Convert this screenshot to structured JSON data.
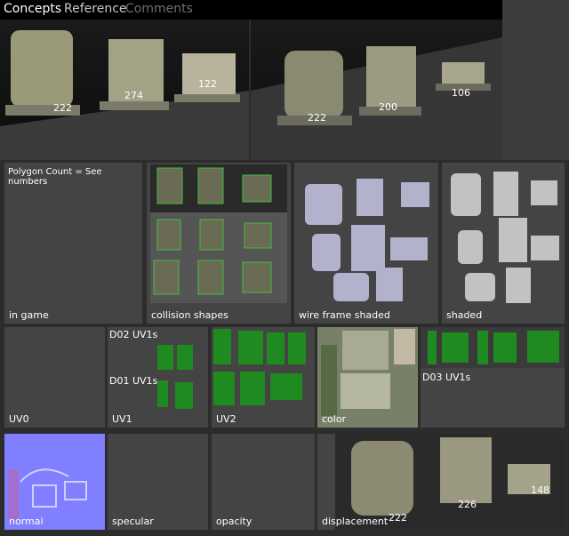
{
  "tabs": [
    {
      "label": "Concepts"
    },
    {
      "label": "Reference"
    },
    {
      "label": "Comments"
    }
  ],
  "hero_left": {
    "counts": [
      "222",
      "274",
      "122"
    ]
  },
  "hero_right": {
    "counts": [
      "222",
      "200",
      "106"
    ]
  },
  "row2": {
    "in_game": {
      "label": "in game",
      "note": "Polygon Count = See numbers"
    },
    "collision": {
      "label": "collision shapes"
    },
    "wireframe": {
      "label": "wire frame shaded"
    },
    "shaded": {
      "label": "shaded"
    }
  },
  "row3": {
    "uv0": {
      "label": "UV0"
    },
    "uv1": {
      "label": "UV1",
      "d02": "D02 UV1s",
      "d01": "D01 UV1s"
    },
    "uv2": {
      "label": "UV2"
    },
    "color": {
      "label": "color"
    },
    "d03": {
      "label": "D03 UV1s"
    }
  },
  "row4": {
    "normal": {
      "label": "normal"
    },
    "specular": {
      "label": "specular"
    },
    "opacity": {
      "label": "opacity"
    },
    "displacement": {
      "label": "displacement",
      "counts": [
        "222",
        "226",
        "148"
      ]
    }
  },
  "colors": {
    "uv_green": "#1f8a1f",
    "normal_blue": "#8080ff",
    "panel": "#444444"
  }
}
